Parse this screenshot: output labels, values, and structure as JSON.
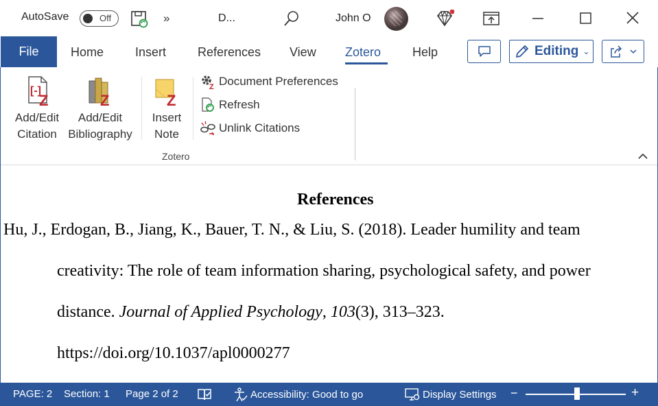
{
  "titlebar": {
    "autosave_label": "AutoSave",
    "autosave_state": "Off",
    "doc_title": "D...",
    "user_name": "John O"
  },
  "tabs": {
    "file": "File",
    "home": "Home",
    "insert": "Insert",
    "references": "References",
    "view": "View",
    "zotero": "Zotero",
    "help": "Help",
    "active": "Zotero",
    "editing_label": "Editing"
  },
  "ribbon": {
    "add_edit_citation": [
      "Add/Edit",
      "Citation"
    ],
    "add_edit_bibliography": [
      "Add/Edit",
      "Bibliography"
    ],
    "insert_note": [
      "Insert",
      "Note"
    ],
    "document_preferences": "Document Preferences",
    "refresh": "Refresh",
    "unlink_citations": "Unlink Citations",
    "group_label": "Zotero"
  },
  "document": {
    "heading": "References",
    "line1": "Hu, J., Erdogan, B., Jiang, K., Bauer, T. N., & Liu, S. (2018). Leader humility and team",
    "line2": "creativity: The role of team information sharing, psychological safety, and power",
    "line3_prefix": "distance. ",
    "line3_journal": "Journal of Applied Psychology",
    "line3_sep": ", ",
    "line3_volume": "103",
    "line3_suffix": "(3), 313–323.",
    "line4": "https://doi.org/10.1037/apl0000277"
  },
  "statusbar": {
    "page": "PAGE: 2",
    "section": "Section: 1",
    "page_of": "Page 2 of 2",
    "accessibility": "Accessibility: Good to go",
    "display_settings": "Display Settings",
    "zoom_minus": "−",
    "zoom_plus": "+"
  },
  "colors": {
    "word_blue": "#2b579a",
    "zotero_red": "#c0272d"
  },
  "icons": [
    "save-icon",
    "more-icon",
    "search-icon",
    "avatar",
    "diamond-icon",
    "ribbon-display-icon",
    "minimize-icon",
    "maximize-icon",
    "close-icon",
    "comment-icon",
    "pencil-icon",
    "share-icon",
    "zotero-citation-icon",
    "zotero-bibliography-icon",
    "zotero-note-icon",
    "gear-icon",
    "refresh-icon",
    "unlink-icon",
    "book-icon",
    "accessibility-icon",
    "display-settings-icon"
  ]
}
